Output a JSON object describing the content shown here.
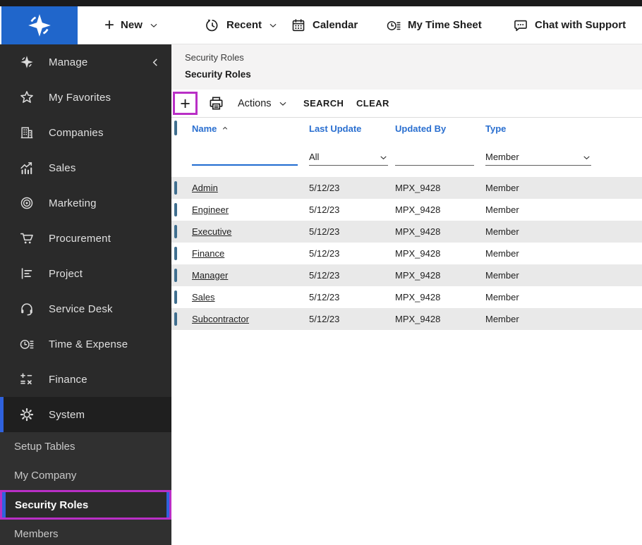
{
  "icons": {
    "plus": "+"
  },
  "topbar": {
    "new_label": "New",
    "recent_label": "Recent",
    "calendar_label": "Calendar",
    "timesheet_label": "My Time Sheet",
    "chat_label": "Chat with Support"
  },
  "sidebar": {
    "product_label": "Manage",
    "items": [
      {
        "label": "My Favorites"
      },
      {
        "label": "Companies"
      },
      {
        "label": "Sales"
      },
      {
        "label": "Marketing"
      },
      {
        "label": "Procurement"
      },
      {
        "label": "Project"
      },
      {
        "label": "Service Desk"
      },
      {
        "label": "Time & Expense"
      },
      {
        "label": "Finance"
      },
      {
        "label": "System"
      }
    ],
    "submenu": [
      {
        "label": "Setup Tables"
      },
      {
        "label": "My Company"
      },
      {
        "label": "Security Roles"
      },
      {
        "label": "Members"
      }
    ]
  },
  "page": {
    "breadcrumb": "Security Roles",
    "title": "Security Roles"
  },
  "toolbar": {
    "actions_label": "Actions",
    "search_label": "SEARCH",
    "clear_label": "CLEAR"
  },
  "table": {
    "columns": {
      "name": "Name",
      "last_update": "Last Update",
      "updated_by": "Updated By",
      "type": "Type"
    },
    "filters": {
      "name_value": "",
      "last_update_value": "All",
      "updated_by_value": "",
      "type_value": "Member"
    },
    "rows": [
      {
        "name": "Admin",
        "last_update": "5/12/23",
        "updated_by": "MPX_9428",
        "type": "Member"
      },
      {
        "name": "Engineer",
        "last_update": "5/12/23",
        "updated_by": "MPX_9428",
        "type": "Member"
      },
      {
        "name": "Executive",
        "last_update": "5/12/23",
        "updated_by": "MPX_9428",
        "type": "Member"
      },
      {
        "name": "Finance",
        "last_update": "5/12/23",
        "updated_by": "MPX_9428",
        "type": "Member"
      },
      {
        "name": "Manager",
        "last_update": "5/12/23",
        "updated_by": "MPX_9428",
        "type": "Member"
      },
      {
        "name": "Sales",
        "last_update": "5/12/23",
        "updated_by": "MPX_9428",
        "type": "Member"
      },
      {
        "name": "Subcontractor",
        "last_update": "5/12/23",
        "updated_by": "MPX_9428",
        "type": "Member"
      }
    ]
  },
  "colors": {
    "logo_blue": "#2066cb",
    "accent_blue": "#2a6fd0",
    "active_bar_blue": "#2f62dd",
    "annotation_magenta": "#b92fc6",
    "row_alt_gray": "#e9e9e9"
  }
}
